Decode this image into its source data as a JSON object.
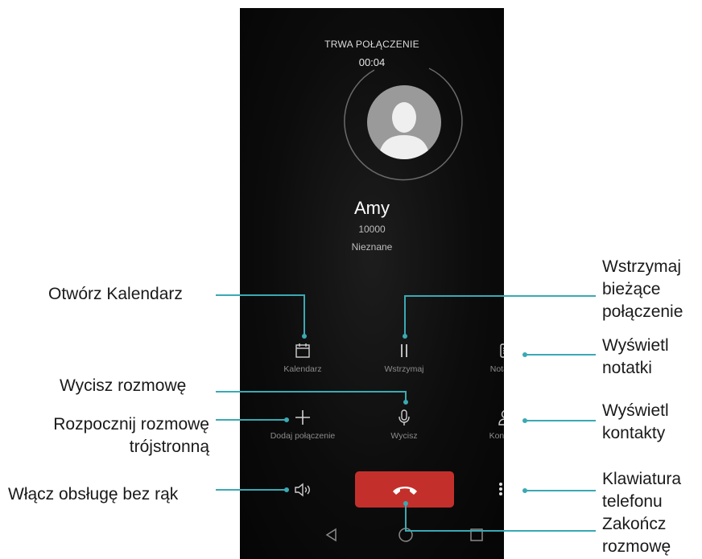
{
  "call": {
    "status": "TRWA POŁĄCZENIE",
    "timer": "00:04",
    "name": "Amy",
    "number": "10000",
    "location": "Nieznane"
  },
  "buttons": {
    "calendar": "Kalendarz",
    "hold": "Wstrzymaj",
    "notes": "Notatnik",
    "add_call": "Dodaj połączenie",
    "mute": "Wycisz",
    "contacts": "Kontakty"
  },
  "annotations": {
    "open_calendar": "Otwórz Kalendarz",
    "hold_line1": "Wstrzymaj",
    "hold_line2": "bieżące",
    "hold_line3": "połączenie",
    "notes_line1": "Wyświetl",
    "notes_line2": "notatki",
    "mute": "Wycisz rozmowę",
    "threeway_line1": "Rozpocznij rozmowę",
    "threeway_line2": "trójstronną",
    "contacts_line1": "Wyświetl",
    "contacts_line2": "kontakty",
    "speaker": "Włącz obsługę bez rąk",
    "keypad_line1": "Klawiatura",
    "keypad_line2": "telefonu",
    "end_line1": "Zakończ",
    "end_line2": "rozmowę"
  },
  "colors": {
    "end_call": "#c3302c",
    "callout_line": "#3aa9b3",
    "screen_bg": "#0c0c0c"
  },
  "icons": [
    "calendar-icon",
    "pause-icon",
    "note-icon",
    "plus-icon",
    "microphone-icon",
    "person-icon",
    "speaker-icon",
    "keypad-icon",
    "phone-hangup-icon",
    "back-icon",
    "home-icon",
    "recents-icon"
  ]
}
